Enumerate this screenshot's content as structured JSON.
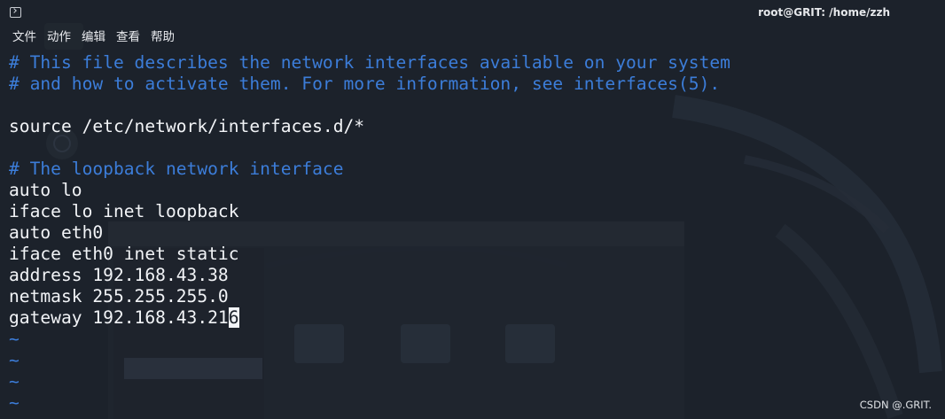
{
  "window": {
    "title": "root@GRIT: /home/zzh",
    "terminal_icon": "terminal-icon"
  },
  "menu": {
    "items": [
      "文件",
      "动作",
      "编辑",
      "查看",
      "帮助"
    ]
  },
  "editor": {
    "lines": [
      {
        "kind": "comment",
        "text": "# This file describes the network interfaces available on your system"
      },
      {
        "kind": "comment",
        "text": "# and how to activate them. For more information, see interfaces(5)."
      },
      {
        "kind": "blank",
        "text": ""
      },
      {
        "kind": "code",
        "text": "source /etc/network/interfaces.d/*"
      },
      {
        "kind": "blank",
        "text": ""
      },
      {
        "kind": "comment",
        "text": "# The loopback network interface"
      },
      {
        "kind": "code",
        "text": "auto lo"
      },
      {
        "kind": "code",
        "text": "iface lo inet loopback"
      },
      {
        "kind": "code",
        "text": "auto eth0"
      },
      {
        "kind": "code",
        "text": "iface eth0 inet static"
      },
      {
        "kind": "code",
        "text": "address 192.168.43.38"
      },
      {
        "kind": "code",
        "text": "netmask 255.255.255.0"
      },
      {
        "kind": "code",
        "text": "gateway 192.168.43.216"
      },
      {
        "kind": "tilde",
        "text": "~"
      },
      {
        "kind": "tilde",
        "text": "~"
      },
      {
        "kind": "tilde",
        "text": "~"
      },
      {
        "kind": "tilde",
        "text": "~"
      }
    ],
    "cursor": {
      "line": 12,
      "column": 21
    }
  },
  "watermark": "CSDN @.GRIT.",
  "colors": {
    "background": "#1c222b",
    "comment": "#3c7dd9",
    "text": "#f2f4f7",
    "cursor": "#f2f4f7"
  }
}
